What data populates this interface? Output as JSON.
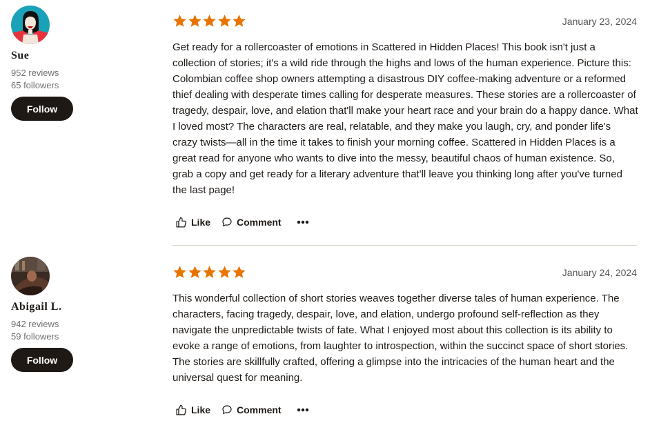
{
  "reviews": [
    {
      "reviewer": {
        "name": "Sue",
        "reviews": "952 reviews",
        "followers": "65 followers",
        "follow_label": "Follow"
      },
      "rating": 5,
      "date": "January 23, 2024",
      "text": "Get ready for a rollercoaster of emotions in Scattered in Hidden Places! This book isn't just a collection of stories; it's a wild ride through the highs and lows of the human experience. Picture this: Colombian coffee shop owners attempting a disastrous DIY coffee-making adventure or a reformed thief dealing with desperate times calling for desperate measures. These stories are a rollercoaster of tragedy, despair, love, and elation that'll make your heart race and your brain do a happy dance. What I loved most? The characters are real, relatable, and they make you laugh, cry, and ponder life's crazy twists—all in the time it takes to finish your morning coffee. Scattered in Hidden Places is a great read for anyone who wants to dive into the messy, beautiful chaos of human existence. So, grab a copy and get ready for a literary adventure that'll leave you thinking long after you've turned the last page!",
      "actions": {
        "like": "Like",
        "comment": "Comment"
      }
    },
    {
      "reviewer": {
        "name": "Abigail L.",
        "reviews": "942 reviews",
        "followers": "59 followers",
        "follow_label": "Follow"
      },
      "rating": 5,
      "date": "January 24, 2024",
      "text": "This wonderful collection of short stories weaves together diverse tales of human experience. The characters, facing tragedy, despair, love, and elation, undergo profound self-reflection as they navigate the unpredictable twists of fate. What I enjoyed most about this collection is its ability to evoke a range of emotions, from laughter to introspection, within the succinct space of short stories. The stories are skillfully crafted, offering a glimpse into the intricacies of the human heart and the universal quest for meaning.",
      "actions": {
        "like": "Like",
        "comment": "Comment"
      }
    }
  ],
  "colors": {
    "star": "#e87400",
    "button": "#1e1915",
    "divider": "#d6d0c4"
  },
  "icons": {
    "rating": "star-icon",
    "like": "thumbs-up-icon",
    "comment": "comment-bubble-icon",
    "more": "more-horizontal-icon"
  }
}
